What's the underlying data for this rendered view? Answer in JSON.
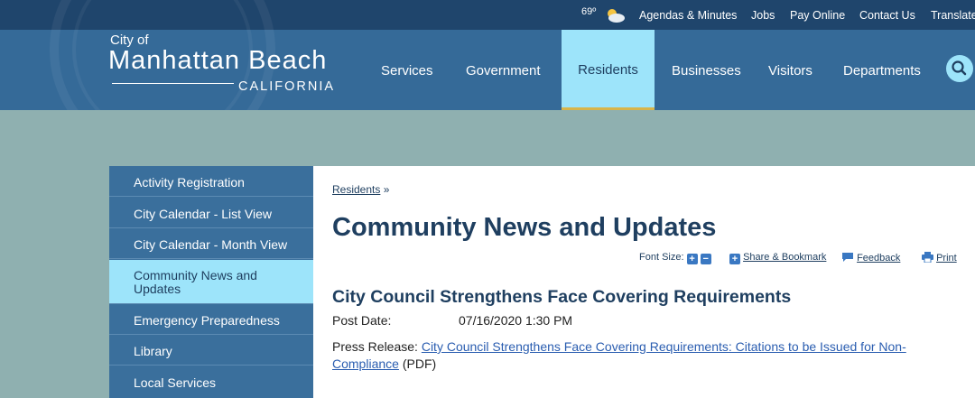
{
  "topbar": {
    "temperature": "69º",
    "links": [
      "Agendas & Minutes",
      "Jobs",
      "Pay Online",
      "Contact Us",
      "Translate"
    ]
  },
  "logo": {
    "city_of": "City of",
    "name": "Manhattan Beach",
    "state": "CALIFORNIA"
  },
  "nav": {
    "items": [
      "Services",
      "Government",
      "Residents",
      "Businesses",
      "Visitors",
      "Departments"
    ],
    "active": "Residents"
  },
  "sidebar": {
    "items": [
      "Activity Registration",
      "City Calendar - List View",
      "City Calendar - Month View",
      "Community News and Updates",
      "Emergency Preparedness",
      "Library",
      "Local Services"
    ],
    "active_index": 3
  },
  "content": {
    "breadcrumb_link": "Residents",
    "breadcrumb_sep": "»",
    "page_title": "Community News and Updates",
    "font_size_label": "Font Size:",
    "share_label": "Share & Bookmark",
    "feedback_label": "Feedback",
    "print_label": "Print",
    "article_title": "City Council Strengthens Face Covering Requirements",
    "post_date_label": "Post Date:",
    "post_date_value": "07/16/2020 1:30 PM",
    "press_label": "Press Release:",
    "press_link": "City Council Strengthens Face Covering Requirements: Citations to be Issued for Non-Compliance",
    "press_suffix": "(PDF)"
  },
  "colors": {
    "header": "#356a98",
    "topbar": "#1f456c",
    "accent": "#9de4fa",
    "title": "#1f3f60",
    "link": "#2a5db0"
  }
}
